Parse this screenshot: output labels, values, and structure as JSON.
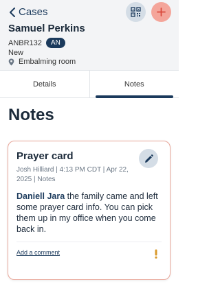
{
  "header": {
    "back_label": "Cases",
    "case_name": "Samuel Perkins",
    "case_id": "ANBR132",
    "badge": "AN",
    "status": "New",
    "location": "Embalming room"
  },
  "tabs": [
    {
      "label": "Details",
      "active": false
    },
    {
      "label": "Notes",
      "active": true
    }
  ],
  "section_title": "Notes",
  "note": {
    "title": "Prayer card",
    "meta": "Josh Hilliard | 4:13 PM CDT | Apr 22, 2025 | Notes",
    "mention": "Daniell Jara",
    "body": " the family came and left some prayer card info. You can pick them up in my office when you come back in.",
    "add_comment_label": "Add a comment"
  },
  "colors": {
    "accent": "#1b3a5c",
    "add_button": "#f4a59a",
    "card_border": "#e8a598",
    "priority": "#d99a2b"
  },
  "icons": {
    "back": "chevron-left-icon",
    "qr": "qr-code-icon",
    "add": "plus-icon",
    "location": "location-pin-icon",
    "edit": "pencil-icon",
    "priority": "exclamation-icon"
  }
}
